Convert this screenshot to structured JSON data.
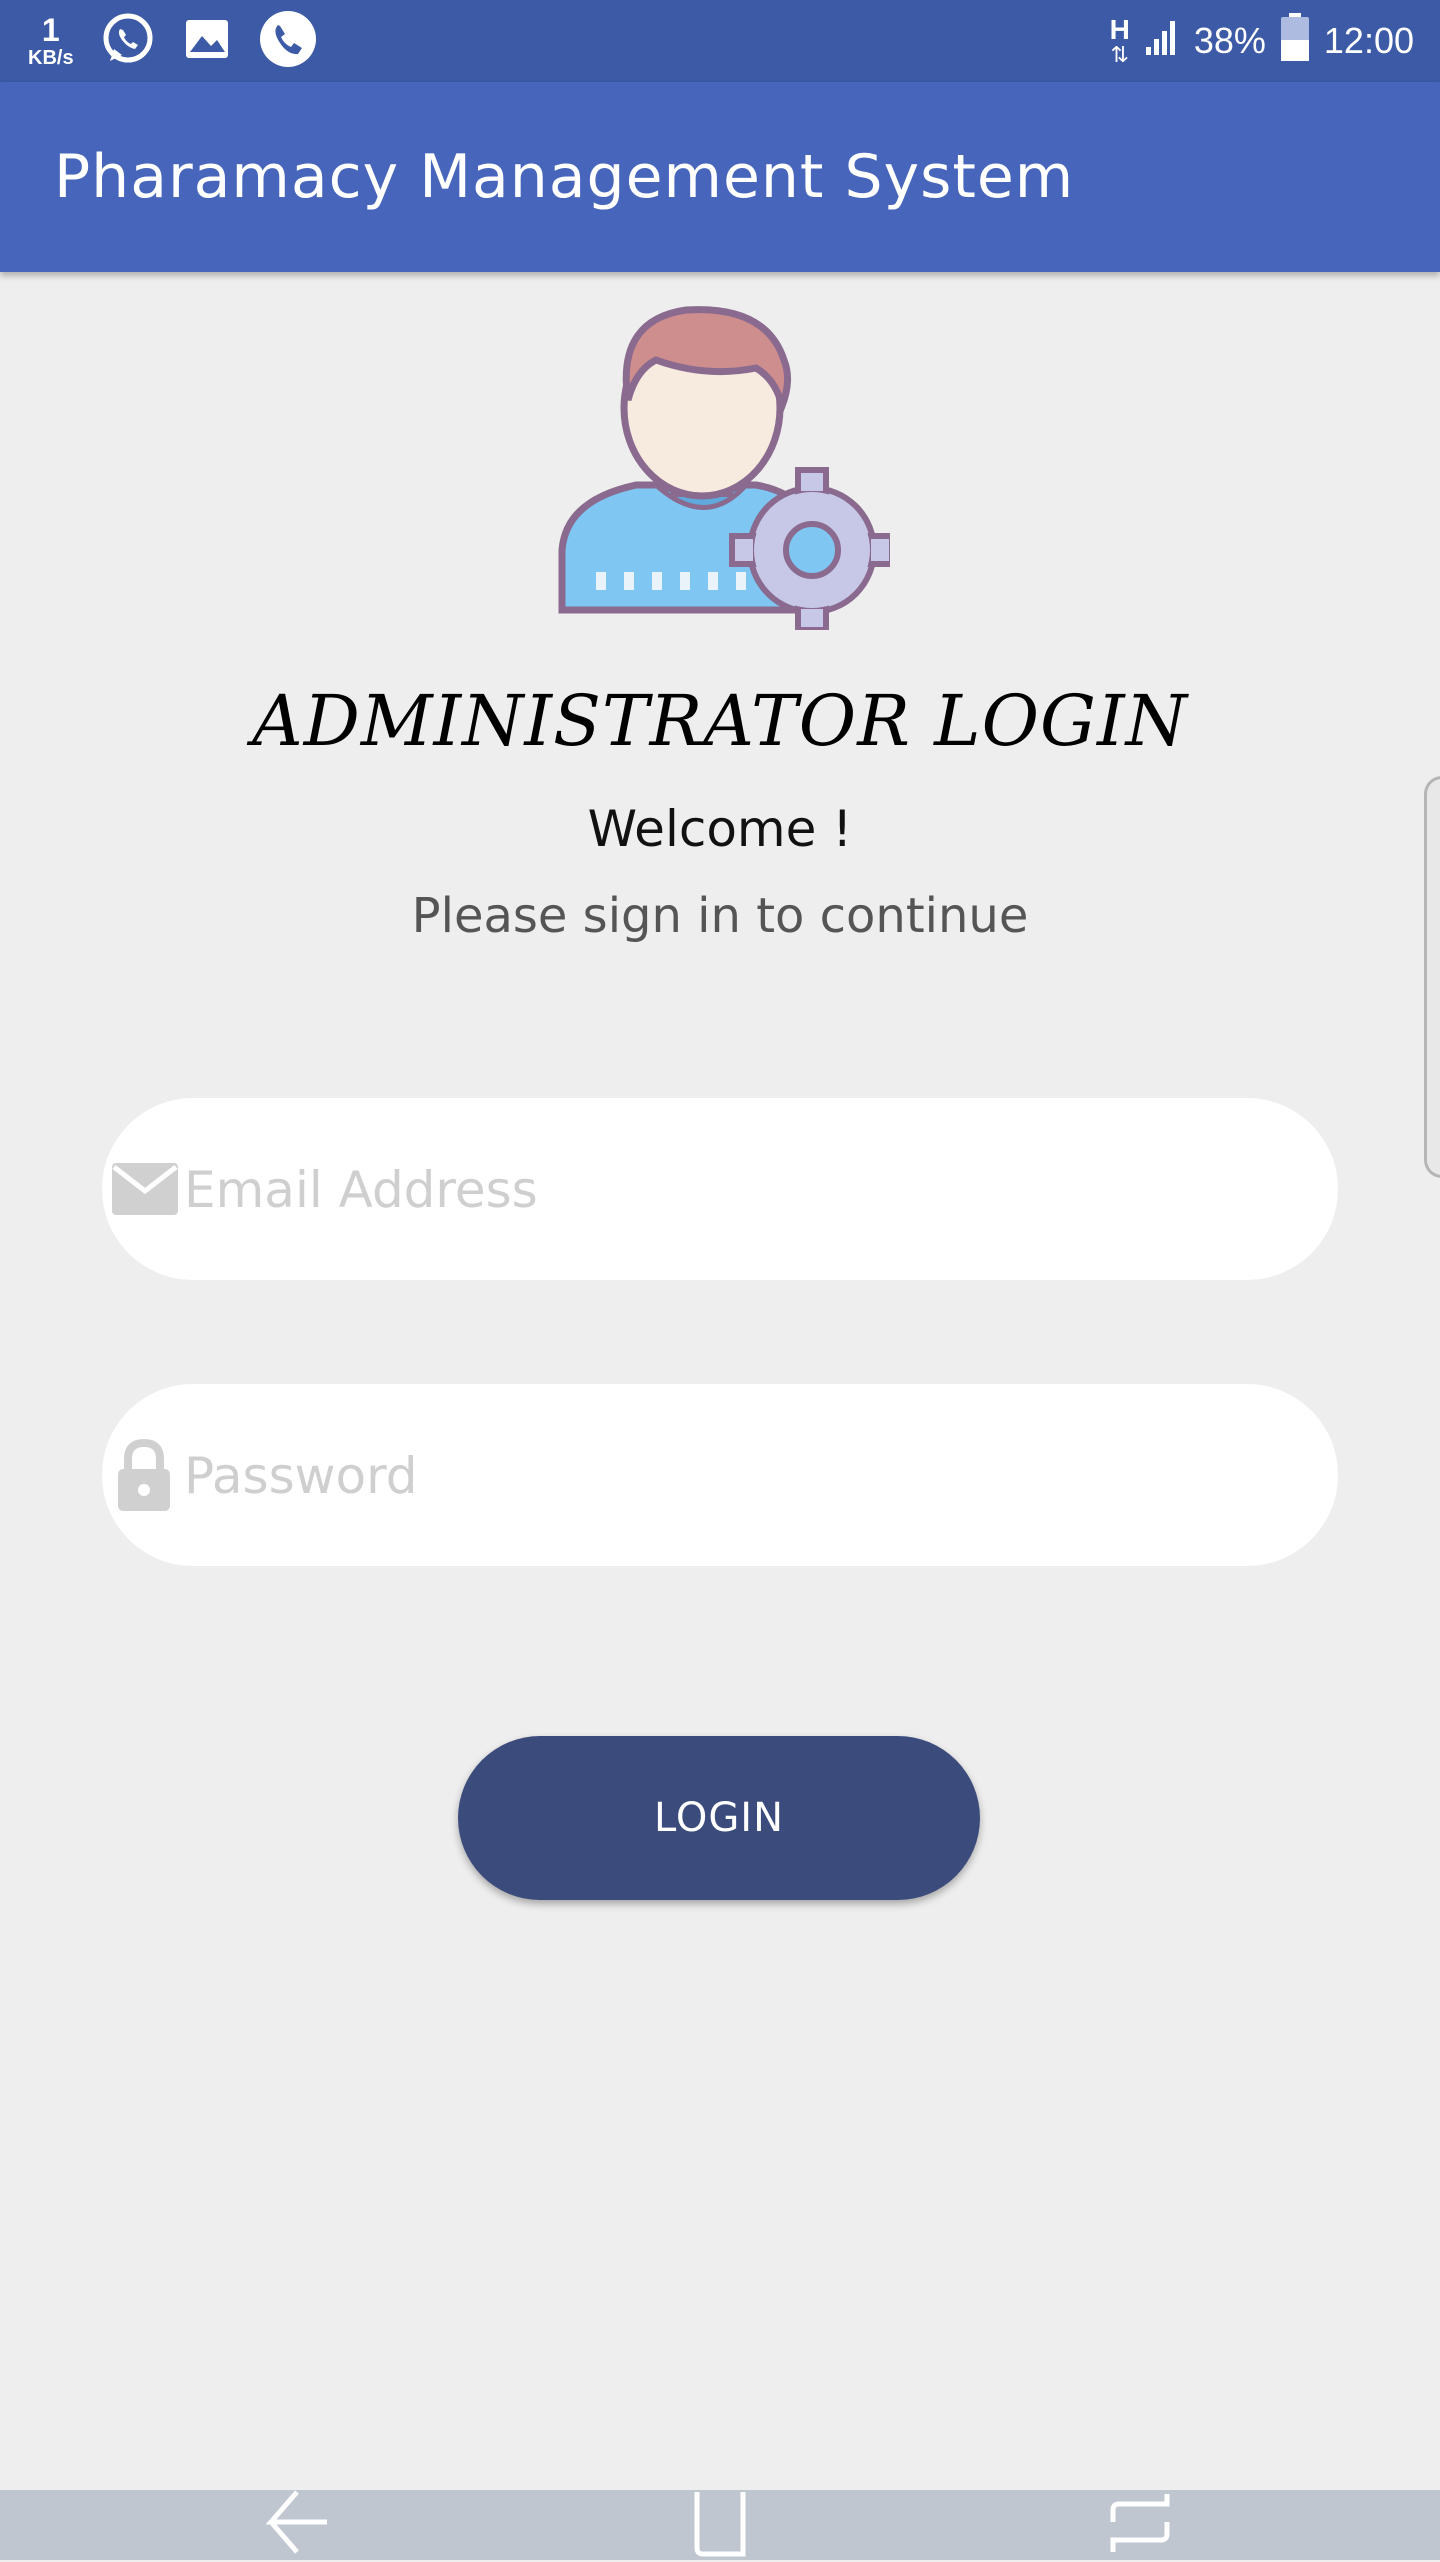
{
  "status_bar": {
    "speed_value": "1",
    "speed_unit": "KB/s",
    "network_type": "H",
    "battery_percent": "38%",
    "time": "12:00",
    "notification_icons": [
      "whatsapp-icon",
      "image-icon",
      "phone-icon"
    ]
  },
  "app_bar": {
    "title": "Pharamacy Management System"
  },
  "login": {
    "heading": "ADMINISTRATOR LOGIN",
    "welcome": "Welcome !",
    "subtitle": "Please sign in to continue",
    "email_placeholder": "Email Address",
    "email_value": "",
    "password_placeholder": "Password",
    "password_value": "",
    "button_label": "LOGIN"
  },
  "nav_bar": {
    "icons": [
      "back-icon",
      "home-icon",
      "recents-icon"
    ]
  },
  "colors": {
    "status_bar": "#3c5aa5",
    "app_bar": "#4766bb",
    "background": "#eeeeee",
    "login_button": "#3b4c7c",
    "nav_bar": "#bfc6d0"
  }
}
